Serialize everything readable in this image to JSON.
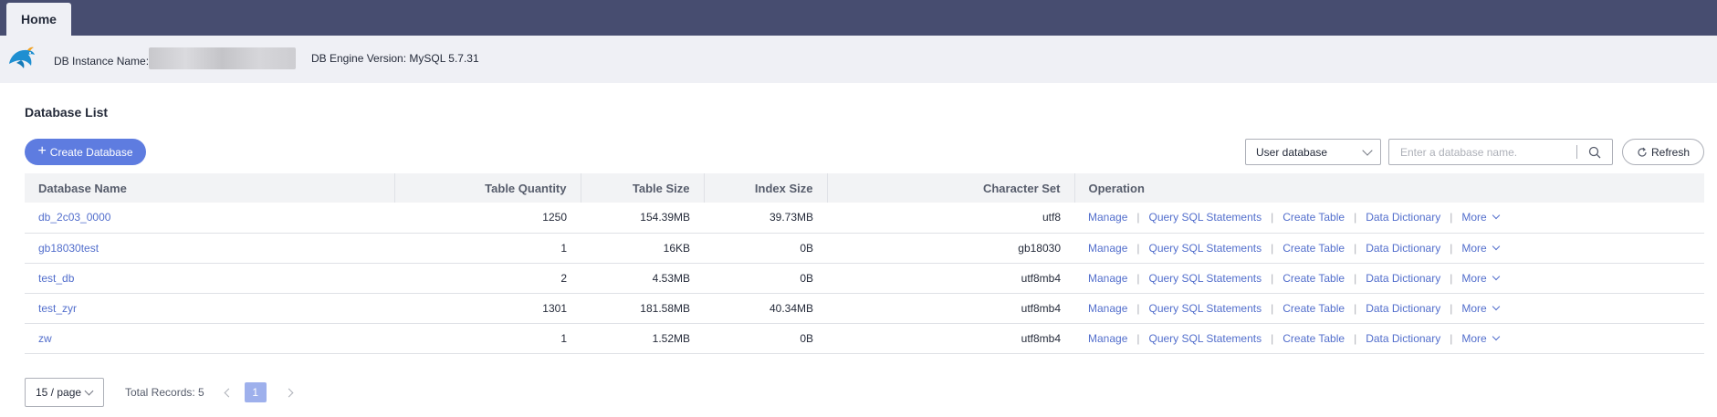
{
  "tabs": [
    {
      "label": "Home"
    }
  ],
  "instance": {
    "name_label": "DB Instance Name:",
    "engine_label": "DB Engine Version: MySQL 5.7.31"
  },
  "section": {
    "title": "Database List"
  },
  "toolbar": {
    "create_label": "Create Database",
    "filter_selected": "User database",
    "search_placeholder": "Enter a database name.",
    "refresh_label": "Refresh"
  },
  "table": {
    "headers": [
      "Database Name",
      "Table Quantity",
      "Table Size",
      "Index Size",
      "Character Set",
      "Operation"
    ],
    "rows": [
      {
        "name": "db_2c03_0000",
        "table_quantity": "1250",
        "table_size": "154.39MB",
        "index_size": "39.73MB",
        "charset": "utf8"
      },
      {
        "name": "gb18030test",
        "table_quantity": "1",
        "table_size": "16KB",
        "index_size": "0B",
        "charset": "gb18030"
      },
      {
        "name": "test_db",
        "table_quantity": "2",
        "table_size": "4.53MB",
        "index_size": "0B",
        "charset": "utf8mb4"
      },
      {
        "name": "test_zyr",
        "table_quantity": "1301",
        "table_size": "181.58MB",
        "index_size": "40.34MB",
        "charset": "utf8mb4"
      },
      {
        "name": "zw",
        "table_quantity": "1",
        "table_size": "1.52MB",
        "index_size": "0B",
        "charset": "utf8mb4"
      }
    ],
    "operations": [
      "Manage",
      "Query SQL Statements",
      "Create Table",
      "Data Dictionary",
      "More"
    ]
  },
  "pagination": {
    "page_size": "15 / page",
    "total": "Total Records: 5",
    "current_page": "1"
  },
  "colors": {
    "topbar": "#474d70",
    "primary": "#5e7ce0",
    "link": "#526ecc"
  }
}
